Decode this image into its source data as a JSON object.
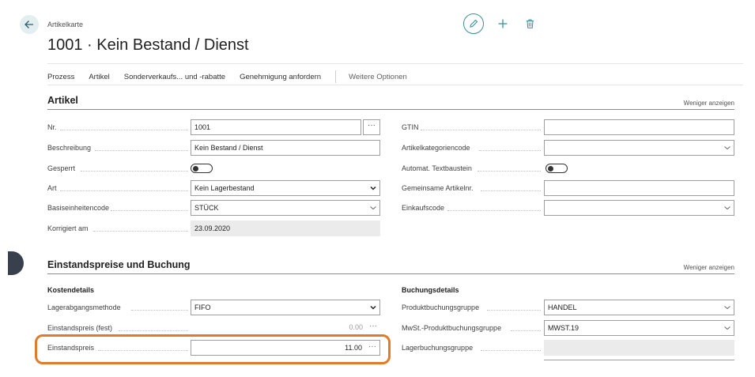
{
  "header": {
    "breadcrumb": "Artikelkarte",
    "title": "1001 · Kein Bestand / Dienst"
  },
  "actions": [
    "Prozess",
    "Artikel",
    "Sonderverkaufs... und -rabatte",
    "Genehmigung anfordern"
  ],
  "more_options": "Weitere Optionen",
  "section_artikel": {
    "title": "Artikel",
    "toggle": "Weniger anzeigen",
    "left": {
      "nr": {
        "label": "Nr.",
        "value": "1001"
      },
      "beschreibung": {
        "label": "Beschreibung",
        "value": "Kein Bestand / Dienst"
      },
      "gesperrt": {
        "label": "Gesperrt"
      },
      "art": {
        "label": "Art",
        "value": "Kein Lagerbestand"
      },
      "basiseinheit": {
        "label": "Basiseinheitencode",
        "value": "STÜCK"
      },
      "korrigiert": {
        "label": "Korrigiert am",
        "value": "23.09.2020"
      }
    },
    "right": {
      "gtin": {
        "label": "GTIN",
        "value": ""
      },
      "kategorie": {
        "label": "Artikelkategoriencode",
        "value": ""
      },
      "textbaustein": {
        "label": "Automat. Textbaustein"
      },
      "gemeinsame": {
        "label": "Gemeinsame Artikelnr.",
        "value": ""
      },
      "einkaufscode": {
        "label": "Einkaufscode",
        "value": ""
      }
    }
  },
  "section_einstand": {
    "title": "Einstandspreise und Buchung",
    "toggle": "Weniger anzeigen",
    "kosten_head": "Kostendetails",
    "buchung_head": "Buchungsdetails",
    "left": {
      "lagerabgang": {
        "label": "Lagerabgangsmethode",
        "value": "FIFO"
      },
      "einstand_fest": {
        "label": "Einstandspreis (fest)",
        "value": "0.00"
      },
      "einstand": {
        "label": "Einstandspreis",
        "value": "11.00"
      }
    },
    "right": {
      "produkt": {
        "label": "Produktbuchungsgruppe",
        "value": "HANDEL"
      },
      "mwst": {
        "label": "MwSt.-Produktbuchungsgruppe",
        "value": "MWST.19"
      },
      "lager": {
        "label": "Lagerbuchungsgruppe",
        "value": ""
      }
    }
  },
  "colors": {
    "accent": "#3a8f98",
    "highlight": "#e07b2a"
  }
}
